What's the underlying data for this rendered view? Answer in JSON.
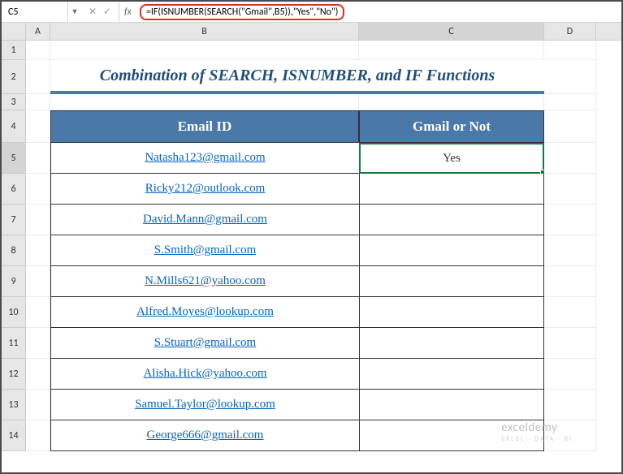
{
  "formula_bar": {
    "cell_ref": "C5",
    "formula": "=IF(ISNUMBER(SEARCH(\"Gmail\",B5)),\"Yes\",\"No\")"
  },
  "columns": {
    "A": "A",
    "B": "B",
    "C": "C",
    "D": "D"
  },
  "row_labels": [
    "1",
    "2",
    "3",
    "4",
    "5",
    "6",
    "7",
    "8",
    "9",
    "10",
    "11",
    "12",
    "13",
    "14"
  ],
  "title": "Combination of SEARCH, ISNUMBER, and IF Functions",
  "headers": {
    "col_b": "Email ID",
    "col_c": "Gmail or Not"
  },
  "rows": [
    {
      "email": "Natasha123@gmail.com",
      "result": "Yes"
    },
    {
      "email": "Ricky212@outlook.com",
      "result": ""
    },
    {
      "email": "David.Mann@gmail.com",
      "result": ""
    },
    {
      "email": "S.Smith@gmail.com",
      "result": ""
    },
    {
      "email": "N.Mills621@yahoo.com",
      "result": ""
    },
    {
      "email": "Alfred.Moyes@lookup.com",
      "result": ""
    },
    {
      "email": "S.Stuart@gmail.com",
      "result": ""
    },
    {
      "email": "Alisha.Hick@yahoo.com",
      "result": ""
    },
    {
      "email": "Samuel.Taylor@lookup.com",
      "result": ""
    },
    {
      "email": "George666@gmail.com",
      "result": ""
    }
  ],
  "watermark": {
    "text": "exceldemy",
    "sub": "EXCEL · DATA · BI"
  }
}
